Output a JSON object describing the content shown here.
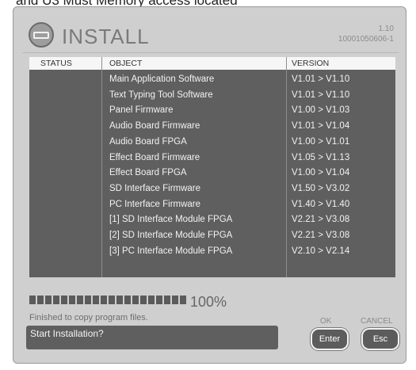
{
  "background_caption": "and U3 Must Memory access located",
  "app": {
    "title": "INSTALL",
    "version_line1": "1.10",
    "version_line2": "10001050606-1",
    "logo_icon": "memory-card-icon"
  },
  "table": {
    "headers": {
      "status": "STATUS",
      "object": "OBJECT",
      "version": "VERSION"
    },
    "rows": [
      {
        "object": "Main Application Software",
        "version": "V1.01 > V1.10"
      },
      {
        "object": "Text Typing Tool Software",
        "version": "V1.01 > V1.10"
      },
      {
        "object": "Panel  Firmware",
        "version": "V1.00 > V1.03"
      },
      {
        "object": "Audio  Board Firmware",
        "version": "V1.01 > V1.04"
      },
      {
        "object": "Audio  Board FPGA",
        "version": "V1.00 > V1.01"
      },
      {
        "object": "Effect  Board Firmware",
        "version": "V1.05 > V1.13"
      },
      {
        "object": "Effect  Board FPGA",
        "version": "V1.00 > V1.04"
      },
      {
        "object": "SD Interface  Firmware",
        "version": "V1.50 > V3.02"
      },
      {
        "object": "PC Interface  Firmware",
        "version": "V1.40 > V1.40"
      },
      {
        "object": "[1] SD Interface Module FPGA",
        "version": "V2.21 > V3.08"
      },
      {
        "object": "[2] SD Interface Module FPGA",
        "version": "V2.21 > V3.08"
      },
      {
        "object": "[3] PC Interface Module FPGA",
        "version": "V2.10 > V2.14"
      }
    ]
  },
  "progress": {
    "fraction": 1.0,
    "percent_label": "100%"
  },
  "status_message": "Finished to copy program files.",
  "prompt": "Start Installation?",
  "buttons": {
    "ok": {
      "caption": "OK",
      "label": "Enter"
    },
    "cancel": {
      "caption": "CANCEL",
      "label": "Esc"
    }
  },
  "colors": {
    "panel": "#cfcfcf",
    "table_bg": "#5f5f5f",
    "header_bg": "#f6f6f6",
    "button_bg": "#5c5c5c"
  }
}
